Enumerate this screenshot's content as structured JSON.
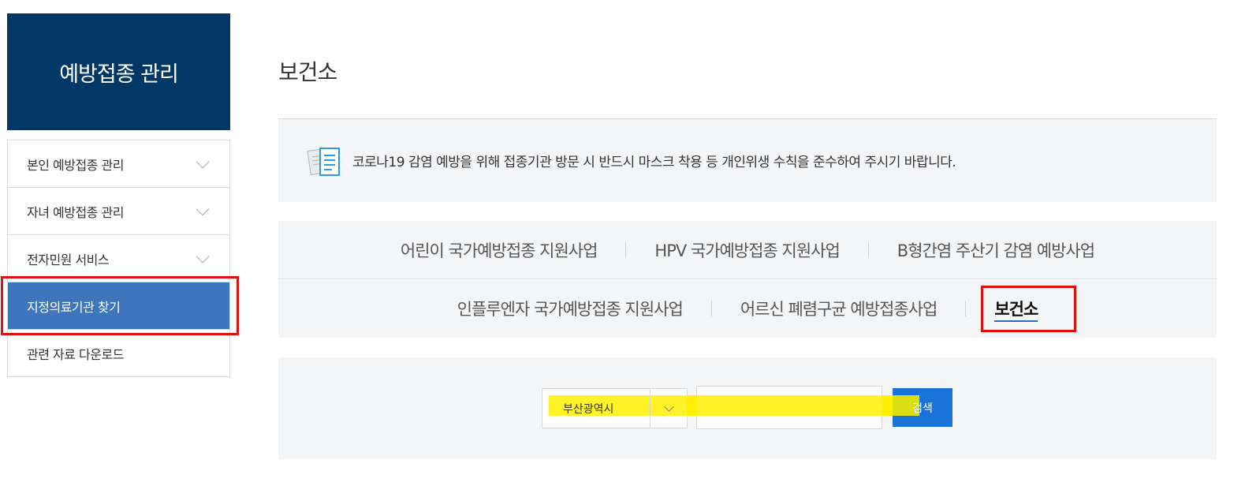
{
  "sidebar": {
    "title": "예방접종 관리",
    "items": [
      {
        "label": "본인 예방접종 관리"
      },
      {
        "label": "자녀 예방접종 관리"
      },
      {
        "label": "전자민원 서비스"
      },
      {
        "label": "지정의료기관 찾기"
      },
      {
        "label": "관련 자료 다운로드"
      }
    ]
  },
  "main": {
    "title": "보건소",
    "notice": "코로나19 감염 예방을 위해 접종기관 방문 시 반드시 마스크 착용 등 개인위생 수칙을 준수하여 주시기 바랍니다.",
    "tabs_row1": [
      {
        "label": "어린이 국가예방접종 지원사업"
      },
      {
        "label": "HPV 국가예방접종 지원사업"
      },
      {
        "label": "B형간염 주산기 감염 예방사업"
      }
    ],
    "tabs_row2": [
      {
        "label": "인플루엔자 국가예방접종 지원사업"
      },
      {
        "label": "어르신 폐렴구균 예방접종사업"
      },
      {
        "label": "보건소"
      }
    ],
    "search": {
      "region_value": "부산광역시",
      "input_value": "",
      "button_label": "검색"
    }
  },
  "colors": {
    "sidebar_header": "#033866",
    "active_item": "#3e76bd",
    "search_button": "#1a73d9",
    "annotation_red": "#e01010",
    "highlight_yellow": "#fff000"
  }
}
